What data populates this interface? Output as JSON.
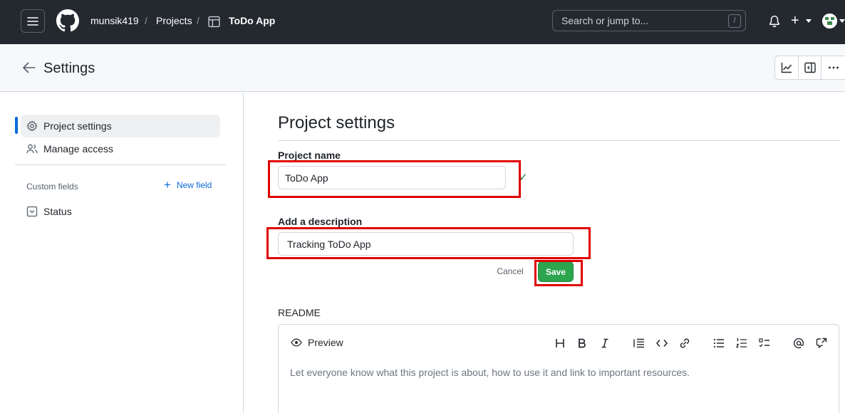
{
  "header": {
    "owner": "munsik419",
    "separator": "/",
    "projects": "Projects",
    "project_name": "ToDo App",
    "search_placeholder": "Search or jump to...",
    "search_shortcut": "/",
    "new_label": "+"
  },
  "titlebar": {
    "title": "Settings"
  },
  "sidebar": {
    "items": [
      {
        "label": "Project settings",
        "icon": "gear-icon",
        "active": true
      },
      {
        "label": "Manage access",
        "icon": "people-icon",
        "active": false
      }
    ],
    "custom_fields_label": "Custom fields",
    "new_field_label": "New field",
    "fields": [
      {
        "label": "Status",
        "icon": "single-select-icon"
      }
    ]
  },
  "main": {
    "title": "Project settings",
    "name_label": "Project name",
    "name_value": "ToDo App",
    "name_check": "✓",
    "description_label": "Add a description",
    "description_value": "Tracking ToDo App",
    "cancel_label": "Cancel",
    "save_label": "Save",
    "readme_label": "README",
    "preview_label": "Preview",
    "readme_placeholder": "Let everyone know what this project is about, how to use it and link to important resources."
  },
  "colors": {
    "header_bg": "#24292f",
    "accent_blue": "#0969da",
    "save_green": "#2da44e",
    "annotation_red": "#e00000"
  }
}
